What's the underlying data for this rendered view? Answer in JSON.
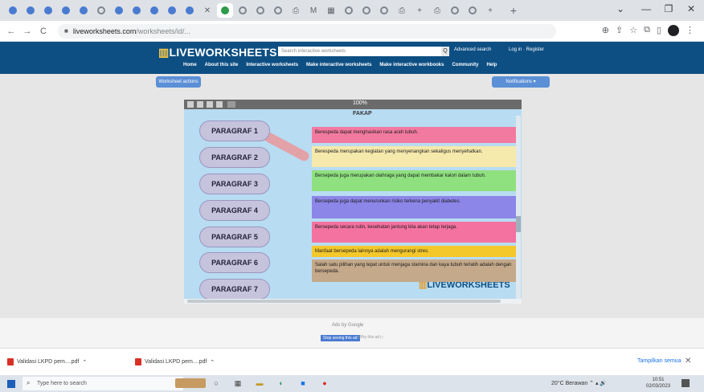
{
  "browser": {
    "tab_icons": [
      "globe",
      "globe",
      "globe",
      "globe",
      "globe",
      "google",
      "globe",
      "globe",
      "globe",
      "globe",
      "globe",
      "close",
      "active",
      "google",
      "google",
      "google",
      "print",
      "mail",
      "grid",
      "google",
      "google",
      "google",
      "print",
      "add",
      "print",
      "google",
      "google",
      "add"
    ],
    "new_tab": "+",
    "window_controls": {
      "dropdown": "⌄",
      "minimize": "—",
      "maximize": "❐",
      "close": "✕"
    },
    "nav": {
      "back": "←",
      "forward": "→",
      "reload": "C"
    },
    "url_host": "liveworksheets.com",
    "url_path": "/worksheets/id/..."
  },
  "site": {
    "logo_mark": "▥",
    "logo_text": "LIVEWORKSHEETS",
    "search_placeholder": "Search interactive worksheets",
    "search_button": "Q",
    "advanced_search": "Advanced search",
    "login": "Log in · Register",
    "nav": [
      "Home",
      "About this site",
      "Interactive worksheets",
      "Make interactive worksheets",
      "Make interactive workbooks",
      "Community",
      "Help"
    ],
    "left_button": "Worksheet actions",
    "right_button": "Notifications ▾"
  },
  "worksheet": {
    "toolbar_title": "100%",
    "heading": "FAKAP",
    "paragraphs": [
      "PARAGRAF 1",
      "PARAGRAF 2",
      "PARAGRAF 3",
      "PARAGRAF 4",
      "PARAGRAF 5",
      "PARAGRAF 6",
      "PARAGRAF 7"
    ],
    "answers": [
      {
        "text": "Berespeda dapat menghasikan rasa arah tubuh.",
        "color": "#f27aa0"
      },
      {
        "text": "Berespeda merupakan kegiatan yang menyenangkan sekaligus menyehatkan.",
        "color": "#f5e9ac"
      },
      {
        "text": "Bersepeda juga merupakan olahraga yang dapat membakar kalori dalam tubuh.",
        "color": "#8fe07f"
      },
      {
        "text": "Bersepeda juga dapat menurunkan risiko terkena penyakit diabetes.",
        "color": "#8c86e8"
      },
      {
        "text": "Bersepeda secara rutin, kesehatan jantung kita akan tetap terjaga.",
        "color": "#f472a0"
      },
      {
        "text": "Manfaat bersepeda lainnya adalah mengurangi stres.",
        "color": "#f4c72a"
      },
      {
        "text": "Salah satu pilihan yang tepat untuk menjaga stamina dan kaya tubuh terlatih adalah dengan bersepeda.",
        "color": "#c4a98a"
      }
    ],
    "watermark": "LIVEWORKSHEETS"
  },
  "translate": {
    "label": "Ads by Google",
    "button": "Stop seeing this ad",
    "select": "Why this ad ▷"
  },
  "downloads": {
    "items": [
      "Validasi LKPD pem....pdf",
      "Validasi LKPD pem....pdf"
    ],
    "show_all": "Tampilkan semua",
    "close": "✕"
  },
  "taskbar": {
    "search_placeholder": "Type here to search",
    "tray": "20°C  Berawan  ⌃  ▴  🔊",
    "time": "10:51",
    "date": "02/03/2023"
  }
}
